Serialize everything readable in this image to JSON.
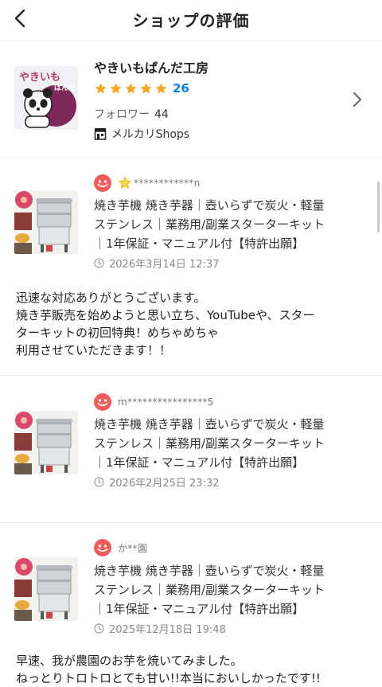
{
  "header": {
    "title": "ショップの評価"
  },
  "shop": {
    "name": "やきいもぱんだ工房",
    "logo_text": "やきいもぱんだ",
    "rating_stars": 5,
    "rating_count": "26",
    "follower_label": "フォロワー",
    "follower_count": "44",
    "shops_label": "メルカリShops"
  },
  "colors": {
    "star": "#f5a623",
    "link": "#0b7fdd",
    "avatar": "#ef5d5d",
    "divider": "#ececec"
  },
  "reviews": [
    {
      "reviewer": "n",
      "reviewer_masked": "************n",
      "badge": "star-badge-icon",
      "item_title_lines": [
        "焼き芋機 焼き芋器｜壺いらずで炭火・軽量",
        "ステンレス｜業務用/副業スターターキット",
        "｜1年保証・マニュアル付【特許出願】"
      ],
      "date": "2026年3月14日 12:37",
      "comment_lines": [
        "迅速な対応ありがとうございます。",
        "焼き芋販売を始めようと思い立ち、YouTubeや、スター",
        "ターキットの初回特典！めちゃめちゃ",
        "利用させていただきます！！"
      ]
    },
    {
      "reviewer": "m****************5",
      "item_title_lines": [
        "焼き芋機 焼き芋器｜壺いらずで炭火・軽量",
        "ステンレス｜業務用/副業スターターキット",
        "｜1年保証・マニュアル付【特許出願】"
      ],
      "date": "2026年2月25日 23:32"
    },
    {
      "reviewer": "か**園",
      "item_title_lines": [
        "焼き芋機 焼き芋器｜壺いらずで炭火・軽量",
        "ステンレス｜業務用/副業スターターキット",
        "｜1年保証・マニュアル付【特許出願】"
      ],
      "date": "2025年12月18日 19:48",
      "comment_lines": [
        "早速、我が農園のお芋を焼いてみました。",
        "ねっとりトロトロとても甘い!!本当においしかったです!!"
      ]
    }
  ]
}
